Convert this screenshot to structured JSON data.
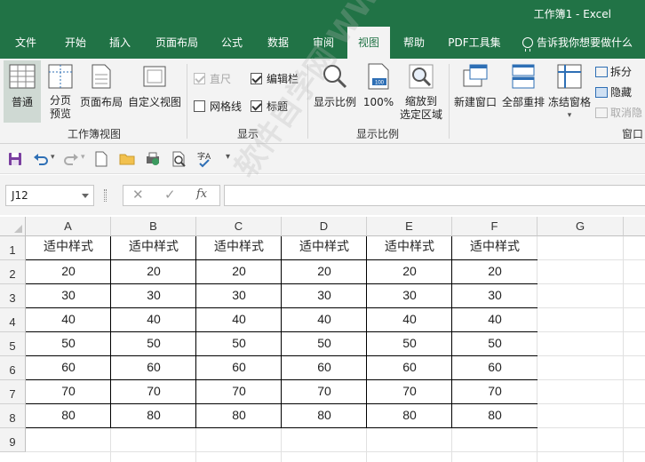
{
  "window": {
    "title": "工作簿1  -  Excel"
  },
  "tabs": [
    {
      "label": "文件"
    },
    {
      "label": "开始"
    },
    {
      "label": "插入"
    },
    {
      "label": "页面布局"
    },
    {
      "label": "公式"
    },
    {
      "label": "数据"
    },
    {
      "label": "审阅"
    },
    {
      "label": "视图"
    },
    {
      "label": "帮助"
    },
    {
      "label": "PDF工具集"
    }
  ],
  "tell_me": "告诉我你想要做什么",
  "ribbon": {
    "workbook_views": {
      "normal": "普通",
      "page_break_1": "分页",
      "page_break_2": "预览",
      "page_layout": "页面布局",
      "custom_views": "自定义视图",
      "group": "工作簿视图"
    },
    "show": {
      "ruler": "直尺",
      "formula_bar": "编辑栏",
      "gridlines": "网格线",
      "headings": "标题",
      "group": "显示"
    },
    "zoom": {
      "zoom": "显示比例",
      "hundred": "100%",
      "zoom_sel_1": "缩放到",
      "zoom_sel_2": "选定区域",
      "group": "显示比例",
      "icon_text": "100"
    },
    "window": {
      "new_window": "新建窗口",
      "arrange_all": "全部重排",
      "freeze_panes": "冻结窗格",
      "split": "拆分",
      "hide": "隐藏",
      "unhide": "取消隐",
      "group": "窗口"
    }
  },
  "name_box": "J12",
  "fx": "fx",
  "columns": [
    "A",
    "B",
    "C",
    "D",
    "E",
    "F",
    "G"
  ],
  "rows": [
    "1",
    "2",
    "3",
    "4",
    "5",
    "6",
    "7",
    "8",
    "9"
  ],
  "table": {
    "header": [
      "适中样式",
      "适中样式",
      "适中样式",
      "适中样式",
      "适中样式",
      "适中样式"
    ],
    "data": [
      [
        "20",
        "20",
        "20",
        "20",
        "20",
        "20"
      ],
      [
        "30",
        "30",
        "30",
        "30",
        "30",
        "30"
      ],
      [
        "40",
        "40",
        "40",
        "40",
        "40",
        "40"
      ],
      [
        "50",
        "50",
        "50",
        "50",
        "50",
        "50"
      ],
      [
        "60",
        "60",
        "60",
        "60",
        "60",
        "60"
      ],
      [
        "70",
        "70",
        "70",
        "70",
        "70",
        "70"
      ],
      [
        "80",
        "80",
        "80",
        "80",
        "80",
        "80"
      ]
    ]
  },
  "watermark": "软件自学网 WWW.RJZXW.COM",
  "colors": {
    "brand": "#217346",
    "ribbon_bg": "#f3f3f3"
  }
}
